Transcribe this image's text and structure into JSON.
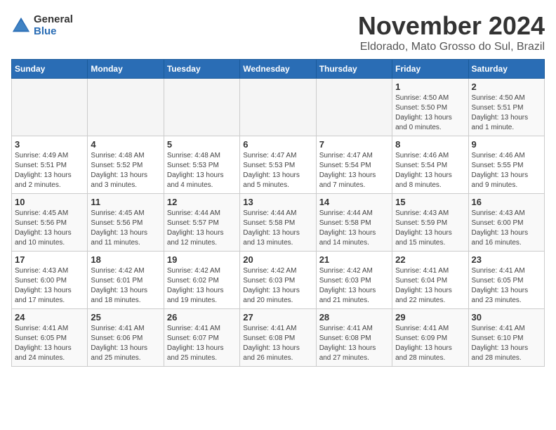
{
  "app": {
    "logo_line1": "General",
    "logo_line2": "Blue"
  },
  "header": {
    "month_year": "November 2024",
    "location": "Eldorado, Mato Grosso do Sul, Brazil"
  },
  "weekdays": [
    "Sunday",
    "Monday",
    "Tuesday",
    "Wednesday",
    "Thursday",
    "Friday",
    "Saturday"
  ],
  "weeks": [
    [
      {
        "day": "",
        "info": ""
      },
      {
        "day": "",
        "info": ""
      },
      {
        "day": "",
        "info": ""
      },
      {
        "day": "",
        "info": ""
      },
      {
        "day": "",
        "info": ""
      },
      {
        "day": "1",
        "info": "Sunrise: 4:50 AM\nSunset: 5:50 PM\nDaylight: 13 hours and 0 minutes."
      },
      {
        "day": "2",
        "info": "Sunrise: 4:50 AM\nSunset: 5:51 PM\nDaylight: 13 hours and 1 minute."
      }
    ],
    [
      {
        "day": "3",
        "info": "Sunrise: 4:49 AM\nSunset: 5:51 PM\nDaylight: 13 hours and 2 minutes."
      },
      {
        "day": "4",
        "info": "Sunrise: 4:48 AM\nSunset: 5:52 PM\nDaylight: 13 hours and 3 minutes."
      },
      {
        "day": "5",
        "info": "Sunrise: 4:48 AM\nSunset: 5:53 PM\nDaylight: 13 hours and 4 minutes."
      },
      {
        "day": "6",
        "info": "Sunrise: 4:47 AM\nSunset: 5:53 PM\nDaylight: 13 hours and 5 minutes."
      },
      {
        "day": "7",
        "info": "Sunrise: 4:47 AM\nSunset: 5:54 PM\nDaylight: 13 hours and 7 minutes."
      },
      {
        "day": "8",
        "info": "Sunrise: 4:46 AM\nSunset: 5:54 PM\nDaylight: 13 hours and 8 minutes."
      },
      {
        "day": "9",
        "info": "Sunrise: 4:46 AM\nSunset: 5:55 PM\nDaylight: 13 hours and 9 minutes."
      }
    ],
    [
      {
        "day": "10",
        "info": "Sunrise: 4:45 AM\nSunset: 5:56 PM\nDaylight: 13 hours and 10 minutes."
      },
      {
        "day": "11",
        "info": "Sunrise: 4:45 AM\nSunset: 5:56 PM\nDaylight: 13 hours and 11 minutes."
      },
      {
        "day": "12",
        "info": "Sunrise: 4:44 AM\nSunset: 5:57 PM\nDaylight: 13 hours and 12 minutes."
      },
      {
        "day": "13",
        "info": "Sunrise: 4:44 AM\nSunset: 5:58 PM\nDaylight: 13 hours and 13 minutes."
      },
      {
        "day": "14",
        "info": "Sunrise: 4:44 AM\nSunset: 5:58 PM\nDaylight: 13 hours and 14 minutes."
      },
      {
        "day": "15",
        "info": "Sunrise: 4:43 AM\nSunset: 5:59 PM\nDaylight: 13 hours and 15 minutes."
      },
      {
        "day": "16",
        "info": "Sunrise: 4:43 AM\nSunset: 6:00 PM\nDaylight: 13 hours and 16 minutes."
      }
    ],
    [
      {
        "day": "17",
        "info": "Sunrise: 4:43 AM\nSunset: 6:00 PM\nDaylight: 13 hours and 17 minutes."
      },
      {
        "day": "18",
        "info": "Sunrise: 4:42 AM\nSunset: 6:01 PM\nDaylight: 13 hours and 18 minutes."
      },
      {
        "day": "19",
        "info": "Sunrise: 4:42 AM\nSunset: 6:02 PM\nDaylight: 13 hours and 19 minutes."
      },
      {
        "day": "20",
        "info": "Sunrise: 4:42 AM\nSunset: 6:03 PM\nDaylight: 13 hours and 20 minutes."
      },
      {
        "day": "21",
        "info": "Sunrise: 4:42 AM\nSunset: 6:03 PM\nDaylight: 13 hours and 21 minutes."
      },
      {
        "day": "22",
        "info": "Sunrise: 4:41 AM\nSunset: 6:04 PM\nDaylight: 13 hours and 22 minutes."
      },
      {
        "day": "23",
        "info": "Sunrise: 4:41 AM\nSunset: 6:05 PM\nDaylight: 13 hours and 23 minutes."
      }
    ],
    [
      {
        "day": "24",
        "info": "Sunrise: 4:41 AM\nSunset: 6:05 PM\nDaylight: 13 hours and 24 minutes."
      },
      {
        "day": "25",
        "info": "Sunrise: 4:41 AM\nSunset: 6:06 PM\nDaylight: 13 hours and 25 minutes."
      },
      {
        "day": "26",
        "info": "Sunrise: 4:41 AM\nSunset: 6:07 PM\nDaylight: 13 hours and 25 minutes."
      },
      {
        "day": "27",
        "info": "Sunrise: 4:41 AM\nSunset: 6:08 PM\nDaylight: 13 hours and 26 minutes."
      },
      {
        "day": "28",
        "info": "Sunrise: 4:41 AM\nSunset: 6:08 PM\nDaylight: 13 hours and 27 minutes."
      },
      {
        "day": "29",
        "info": "Sunrise: 4:41 AM\nSunset: 6:09 PM\nDaylight: 13 hours and 28 minutes."
      },
      {
        "day": "30",
        "info": "Sunrise: 4:41 AM\nSunset: 6:10 PM\nDaylight: 13 hours and 28 minutes."
      }
    ]
  ]
}
